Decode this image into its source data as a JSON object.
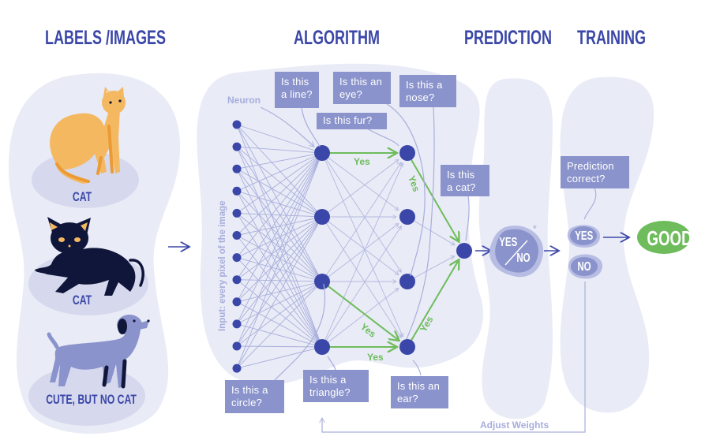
{
  "headers": {
    "labels_images": "LABELS /IMAGES",
    "algorithm": "ALGORITHM",
    "prediction": "PREDICTION",
    "training": "TRAINING"
  },
  "images": [
    {
      "label": "CAT",
      "icon": "orange-cat-icon"
    },
    {
      "label": "CAT",
      "icon": "black-cat-icon"
    },
    {
      "label": "CUTE, BUT NO CAT",
      "icon": "dog-icon"
    }
  ],
  "network": {
    "neuron_label": "Neuron",
    "input_label": "Input: every pixel of the image",
    "input_neuron_count": 12,
    "questions": {
      "line": "Is this a line?",
      "eye": "Is this an eye?",
      "nose": "Is this a nose?",
      "fur": "Is this fur?",
      "cat": "Is this a cat?",
      "circle": "Is this a circle?",
      "triangle": "Is this a triangle?",
      "ear": "Is this an ear?"
    },
    "yes_labels": [
      "Yes",
      "Yes",
      "Yes",
      "Yes",
      "Yes"
    ]
  },
  "prediction": {
    "yes": "YES",
    "no": "NO",
    "asterisk": "*"
  },
  "training": {
    "question": "Prediction correct?",
    "yes": "YES",
    "no": "NO",
    "result": "GOOD",
    "feedback": "Adjust Weights"
  },
  "colors": {
    "primary": "#3b47a8",
    "box": "#8a93cb",
    "panel": "#e9ebf6",
    "blob": "#d6d9ee",
    "line": "#a9afdc",
    "green": "#6ebc5c",
    "orange_cat": "#f4b860",
    "black_cat": "#10163a",
    "dog": "#8a93cb"
  }
}
